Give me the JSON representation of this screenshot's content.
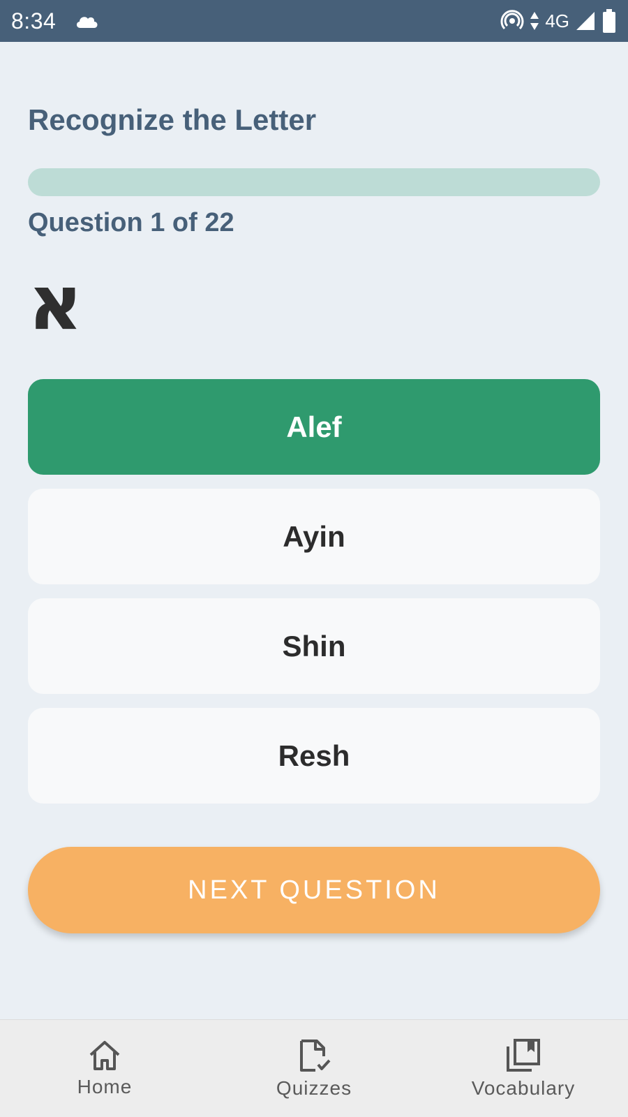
{
  "status_bar": {
    "time": "8:34",
    "network": "4G",
    "icons": [
      "cloud-icon",
      "hotspot-icon",
      "data-arrows-icon",
      "signal-icon",
      "battery-icon"
    ]
  },
  "quiz": {
    "title": "Recognize the Letter",
    "progress_fraction": 0,
    "question_label": "Question 1 of 22",
    "letter": "א",
    "options": [
      {
        "label": "Alef",
        "selected": true
      },
      {
        "label": "Ayin",
        "selected": false
      },
      {
        "label": "Shin",
        "selected": false
      },
      {
        "label": "Resh",
        "selected": false
      }
    ],
    "next_label": "NEXT QUESTION"
  },
  "nav": {
    "items": [
      {
        "label": "Home",
        "icon": "home-icon"
      },
      {
        "label": "Quizzes",
        "icon": "quiz-icon"
      },
      {
        "label": "Vocabulary",
        "icon": "vocabulary-icon"
      }
    ]
  },
  "colors": {
    "status_bar": "#476079",
    "title": "#476079",
    "selected_option": "#2F9A6E",
    "progress_track": "#BDDCD6",
    "next_button": "#F7B163",
    "background": "#EAEFF4"
  }
}
